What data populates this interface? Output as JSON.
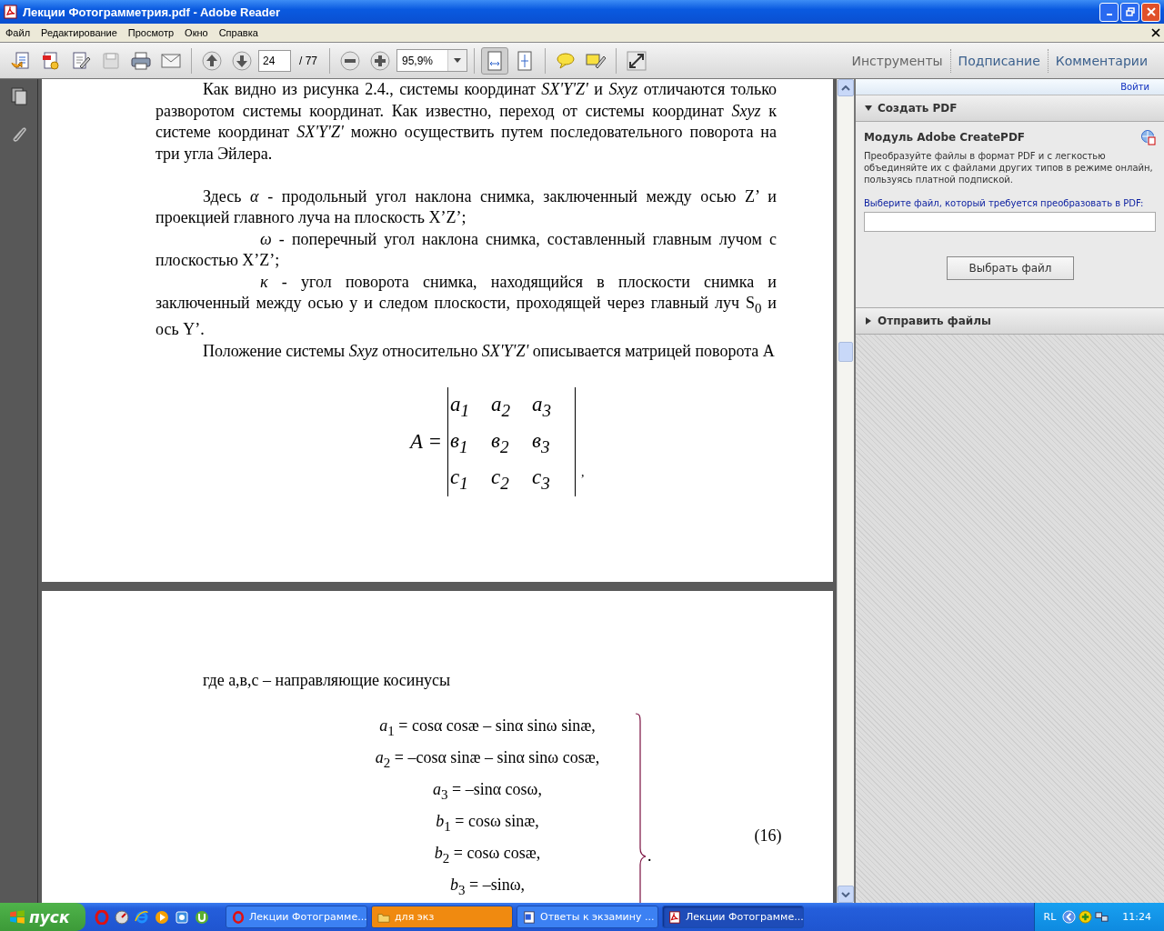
{
  "window": {
    "title": "Лекции Фотограмметрия.pdf - Adobe Reader"
  },
  "menu": [
    "Файл",
    "Редактирование",
    "Просмотр",
    "Окно",
    "Справка"
  ],
  "toolbar": {
    "page": "24",
    "page_total": "/ 77",
    "zoom": "95,9%",
    "tabs": [
      {
        "label": "Инструменты",
        "disabled": true
      },
      {
        "label": "Подписание",
        "disabled": false
      },
      {
        "label": "Комментарии",
        "disabled": false
      }
    ]
  },
  "page1": {
    "paragraphs": [
      {
        "kind": "indent",
        "text": "Как видно из рисунка 2.4., системы координат *SX'Y'Z'* и *Sxyz* отличаются только разворотом системы координат. Как известно, переход от системы координат *Sxyz* к системе координат *SX'Y'Z'* можно осуществить путем последовательного поворота на три угла Эйлера."
      },
      {
        "kind": "indent",
        "text": "Здесь *α*  - продольный угол наклона снимка, заключенный между осью Z’ и проекцией главного луча на плоскость X’Z’;"
      },
      {
        "kind": "deep",
        "text": "*ω* - поперечный угол наклона снимка, составленный главным лучом с плоскостью X’Z’;"
      },
      {
        "kind": "deep",
        "text": "*κ* - угол поворота снимка, находящийся в плоскости снимка и заключенный между осью у и следом плоскости, проходящей через главный луч S$_{0}$ и ось Y’."
      },
      {
        "kind": "indent",
        "text": "Положение системы *Sxyz* относительно *SX'Y'Z'* описывается матрицей поворота А"
      }
    ],
    "matrix": {
      "label": "A =",
      "trail": ",",
      "rows": [
        [
          "a$_{1}$",
          "a$_{2}$",
          "a$_{3}$"
        ],
        [
          "в$_{1}$",
          "в$_{2}$",
          "в$_{3}$"
        ],
        [
          "c$_{1}$",
          "c$_{2}$",
          "c$_{3}$"
        ]
      ]
    }
  },
  "page2": {
    "intro": "где а,в,с – направляющие косинусы",
    "equations": [
      "*a*$_{1}$ = cosα cosæ – sinα sinω sinæ,",
      "*a*$_{2}$ = –cosα sinæ – sinα sinω cosæ,",
      "*a*$_{3}$ = –sinα cosω,",
      "*b*$_{1}$ = cosω sinæ,",
      "*b*$_{2}$ = cosω cosæ,",
      "*b*$_{3}$ = –sinω,"
    ],
    "trail": ".",
    "number": "(16)"
  },
  "right_pane": {
    "login": "Войти",
    "sections": [
      {
        "title": "Создать PDF",
        "expanded": true
      },
      {
        "title": "Отправить файлы",
        "expanded": false
      }
    ],
    "module_title": "Модуль Adobe CreatePDF",
    "description": "Преобразуйте файлы в формат PDF и с легкостью объединяйте их с файлами других типов в режиме онлайн, пользуясь платной подпиской.",
    "prompt": "Выберите файл, который требуется преобразовать в PDF:",
    "button": "Выбрать файл"
  },
  "taskbar": {
    "start": "пуск",
    "tasks": [
      {
        "kind": "opera",
        "label": "Лекции Фотограмме...",
        "selected": false,
        "flashing": false
      },
      {
        "kind": "folder",
        "label": "для экз",
        "selected": false,
        "flashing": true
      },
      {
        "kind": "doc",
        "label": "Ответы к экзамину ...",
        "selected": false,
        "flashing": false
      },
      {
        "kind": "pdf",
        "label": "Лекции Фотограмме...",
        "selected": true,
        "flashing": false
      }
    ],
    "lang": "RL",
    "clock": "11:24"
  }
}
